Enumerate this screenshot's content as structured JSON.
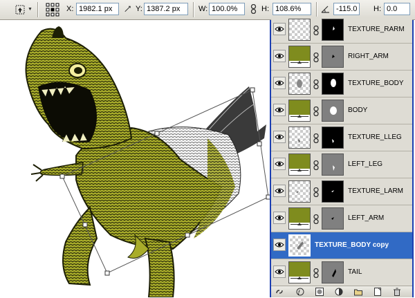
{
  "options_bar": {
    "x_label": "X:",
    "x_value": "1982.1 px",
    "y_label": "Y:",
    "y_value": "1387.2 px",
    "w_label": "W:",
    "w_value": "100.0%",
    "h_label": "H:",
    "h_value": "108.6%",
    "angle_value": "-115.0",
    "skew_h_label": "H:",
    "skew_h_value": "0.0"
  },
  "layers": [
    {
      "name": "TEXTURE_RARM",
      "type": "texture",
      "mask": "black"
    },
    {
      "name": "RIGHT_ARM",
      "type": "solid",
      "mask": "gray"
    },
    {
      "name": "TEXTURE_BODY",
      "type": "texture",
      "mask": "black"
    },
    {
      "name": "BODY",
      "type": "solid",
      "mask": "gray"
    },
    {
      "name": "TEXTURE_LLEG",
      "type": "texture",
      "mask": "black"
    },
    {
      "name": "LEFT_LEG",
      "type": "solid",
      "mask": "gray"
    },
    {
      "name": "TEXTURE_LARM",
      "type": "texture",
      "mask": "black"
    },
    {
      "name": "LEFT_ARM",
      "type": "solid",
      "mask": "gray"
    },
    {
      "name": "TEXTURE_BODY copy",
      "type": "texture",
      "mask": "none",
      "selected": true
    },
    {
      "name": "TAIL",
      "type": "solid",
      "mask": "gray"
    }
  ],
  "colors": {
    "fill_olive": "#7f8c1e",
    "selection_blue": "#316ac5",
    "panel_border": "#1c3fb2"
  }
}
